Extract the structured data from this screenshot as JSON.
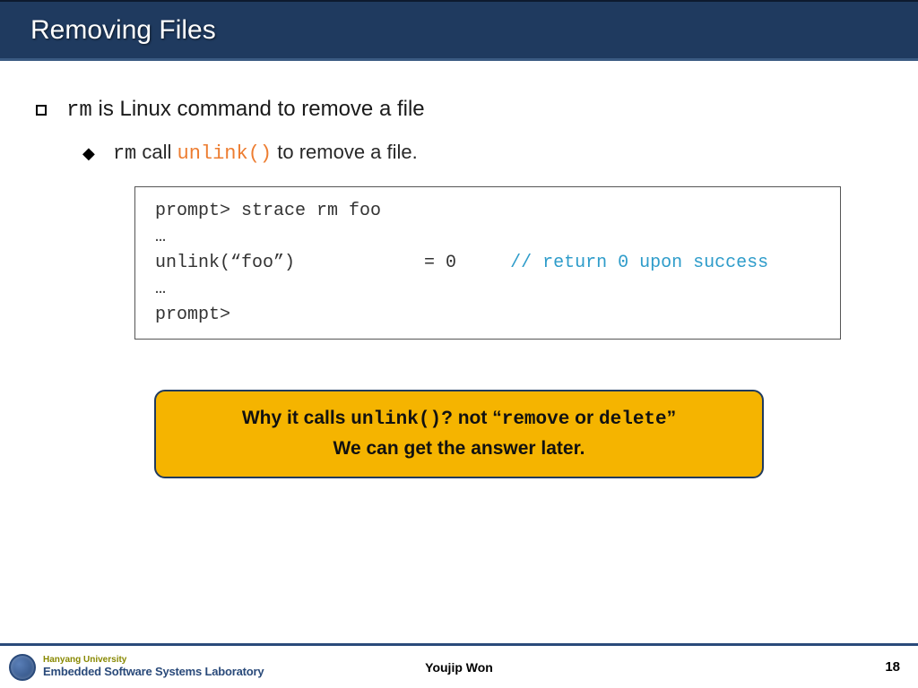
{
  "header": {
    "title": "Removing Files"
  },
  "bullet1": {
    "cmd": "rm",
    "text_after": " is Linux command to remove a file"
  },
  "sub1": {
    "cmd": "rm",
    "mid": " call ",
    "func": "unlink()",
    "tail": " to remove a file."
  },
  "code": {
    "l1": "prompt> strace rm foo",
    "l2": "…",
    "l3a": "unlink(“foo”)            = 0     ",
    "l3b": "// return 0 upon success",
    "l4": "…",
    "l5": "prompt>"
  },
  "callout": {
    "pre": "Why it calls ",
    "func": "unlink()",
    "mid1": "? not “",
    "kw1": "remove",
    "mid2": " or ",
    "kw2": "delete",
    "post1": "”",
    "line2": "We can get the answer later."
  },
  "footer": {
    "university": "Hanyang University",
    "lab": "Embedded Software Systems Laboratory",
    "author": "Youjip Won",
    "page": "18"
  }
}
